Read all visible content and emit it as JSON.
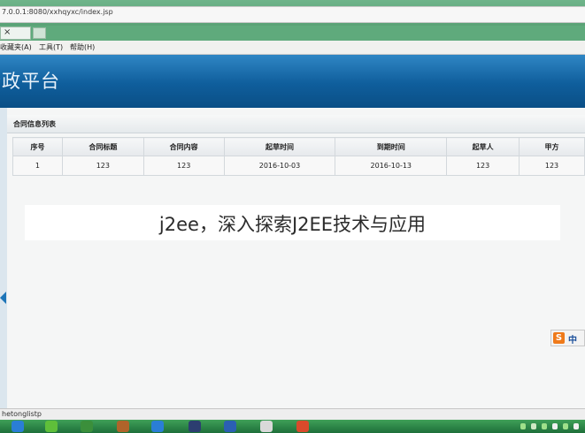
{
  "browser": {
    "address": "7.0.0.1:8080/xxhqyxc/index.jsp",
    "tab_close": "×",
    "menu": [
      "收藏夹(A)",
      "工具(T)",
      "帮助(H)"
    ]
  },
  "banner": {
    "title": "行政平台"
  },
  "panel": {
    "title": "合同信息列表",
    "columns": [
      "序号",
      "合同标题",
      "合同内容",
      "起草时间",
      "到期时间",
      "起草人",
      "甲方"
    ],
    "rows": [
      [
        "1",
        "123",
        "123",
        "2016-10-03",
        "2016-10-13",
        "123",
        "123"
      ]
    ]
  },
  "watermark": {
    "text": "j2ee，深入探索J2EE技术与应用"
  },
  "ime": {
    "logo": "S",
    "label": "中"
  },
  "status": {
    "text": "hetonglistp"
  },
  "taskbar": {
    "icons": [
      "ie-icon",
      "chrome-icon",
      "paw-icon",
      "book-icon",
      "ie-icon",
      "eclipse-icon",
      "word-icon",
      "java-icon",
      "app-icon"
    ],
    "colors": [
      "#2a7ed6",
      "#5fbf3a",
      "#3b8f3b",
      "#b0642a",
      "#2a7ed6",
      "#2c3e70",
      "#2b5fb3",
      "#d9d9d9",
      "#d94a2b"
    ]
  }
}
